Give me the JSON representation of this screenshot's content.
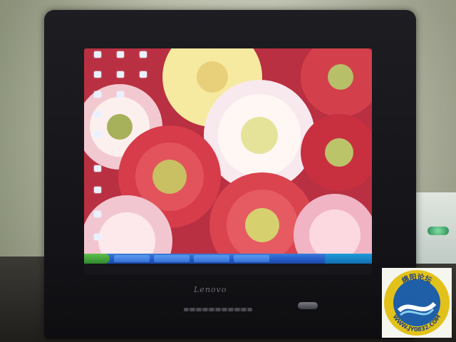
{
  "photo": {
    "subject": "CRT monitor displaying a flower desktop wallpaper",
    "monitor_brand": "Lenovo"
  },
  "screen": {
    "wallpaper": "gerbera-daisies",
    "colors": {
      "red_petal": "#d73c4a",
      "pink_petal": "#f0a0b4",
      "white_petal": "#fbf3e6",
      "yellow_petal": "#f6eaa0",
      "center": "#c8c062"
    }
  },
  "taskbar": {
    "start_icon": "start-button-icon",
    "tasks_count": 4
  },
  "watermark": {
    "top_text": "绵阳论坛",
    "bottom_text": "WWW.JY0832.COM",
    "colors": {
      "ring": "#e2c21a",
      "inner": "#1f5fa8",
      "road": "#ffffff"
    }
  }
}
